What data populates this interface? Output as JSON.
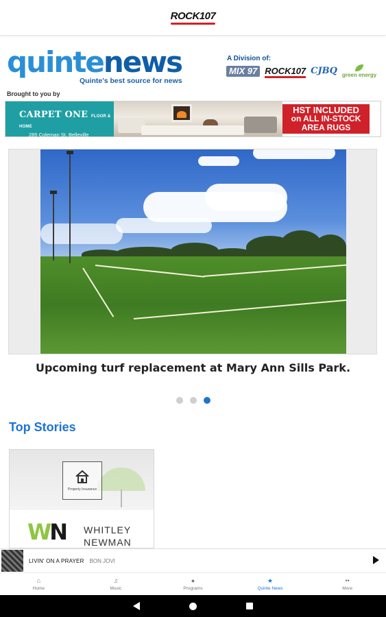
{
  "app_bar": {
    "station_logo": "ROCK107"
  },
  "header": {
    "logo_part1": "quinte",
    "logo_part2": "news",
    "tagline": "Quinte's best source for news",
    "division_label": "A Division of:",
    "brands": [
      "MIX 97",
      "ROCK107",
      "CJBQ",
      "green energy"
    ]
  },
  "sponsor": {
    "brought_by": "Brought to you by",
    "company": "CARPET ONE",
    "company_small": "FLOOR & HOME",
    "address": "285 Coleman St. Belleville",
    "promo_line1": "HST INCLUDED",
    "promo_line2": "on ALL IN-STOCK",
    "promo_line3": "AREA RUGS"
  },
  "carousel": {
    "caption": "Upcoming turf replacement at Mary Ann Sills Park.",
    "total_slides": 3,
    "active_slide": 3
  },
  "top_stories": {
    "title": "Top Stories",
    "card": {
      "property_label": "Property Insurance",
      "logo_letters_1": "W",
      "logo_letters_2": "N",
      "name_line1": "WHITLEY",
      "name_line2": "NEWMAN"
    }
  },
  "player": {
    "track": "LIVIN' ON A PRAYER",
    "artist": "BON JOVI"
  },
  "nav": {
    "items": [
      {
        "label": "Home",
        "icon": "home-icon"
      },
      {
        "label": "Music",
        "icon": "music-note-icon"
      },
      {
        "label": "Programs",
        "icon": "microphone-icon"
      },
      {
        "label": "Quinte News",
        "icon": "star-icon"
      },
      {
        "label": "More",
        "icon": "more-icon"
      }
    ],
    "active_index": 3
  },
  "colors": {
    "accent": "#1e73d2",
    "brand_red": "#d31f26",
    "sponsor_teal": "#1f9fa3"
  }
}
